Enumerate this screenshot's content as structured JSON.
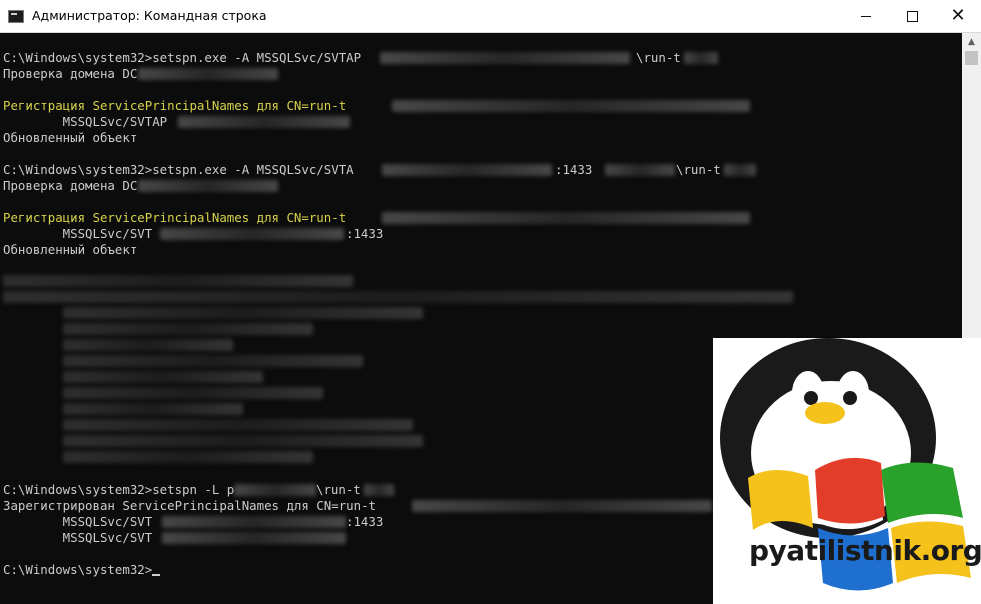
{
  "window": {
    "title": "Администратор: Командная строка",
    "icon": "cmd-icon",
    "controls": {
      "minimize": "minimize-icon",
      "maximize": "maximize-icon",
      "close": "close-icon"
    }
  },
  "console": {
    "block1": {
      "cmd_prefix": "C:\\Windows\\system32>setspn.exe -A MSSQLSvc/SVTAP",
      "cmd_suffix": "\\run-t",
      "check": "Проверка домена DC",
      "register": "Регистрация ServicePrincipalNames для CN=run-t",
      "spn": "        MSSQLSvc/SVTAP",
      "updated": "Обновленный объект"
    },
    "block2": {
      "cmd_prefix": "C:\\Windows\\system32>setspn.exe -A MSSQLSvc/SVTA",
      "port": ":1433",
      "cmd_suffix": "\\run-t",
      "check": "Проверка домена DC",
      "register": "Регистрация ServicePrincipalNames для CN=run-t",
      "spn": "        MSSQLSvc/SVT",
      "spn_port": ":1433",
      "updated": "Обновленный объект"
    },
    "block3": {
      "cmd_prefix": "C:\\Windows\\system32>setspn -L p",
      "cmd_suffix": "\\run-t",
      "registered": "Зарегистрирован ServicePrincipalNames для CN=run-t",
      "spn1": "        MSSQLSvc/SVT",
      "spn1_port": ":1433",
      "spn2": "        MSSQLSvc/SVT"
    },
    "prompt": "C:\\Windows\\system32>"
  },
  "logo": {
    "text": "pyatilistnik.org",
    "image": "penguin-windows-logo"
  },
  "colors": {
    "console_bg": "#0c0c0c",
    "console_text": "#cccccc",
    "highlight_text": "#d8d34a",
    "titlebar_bg": "#ffffff"
  }
}
